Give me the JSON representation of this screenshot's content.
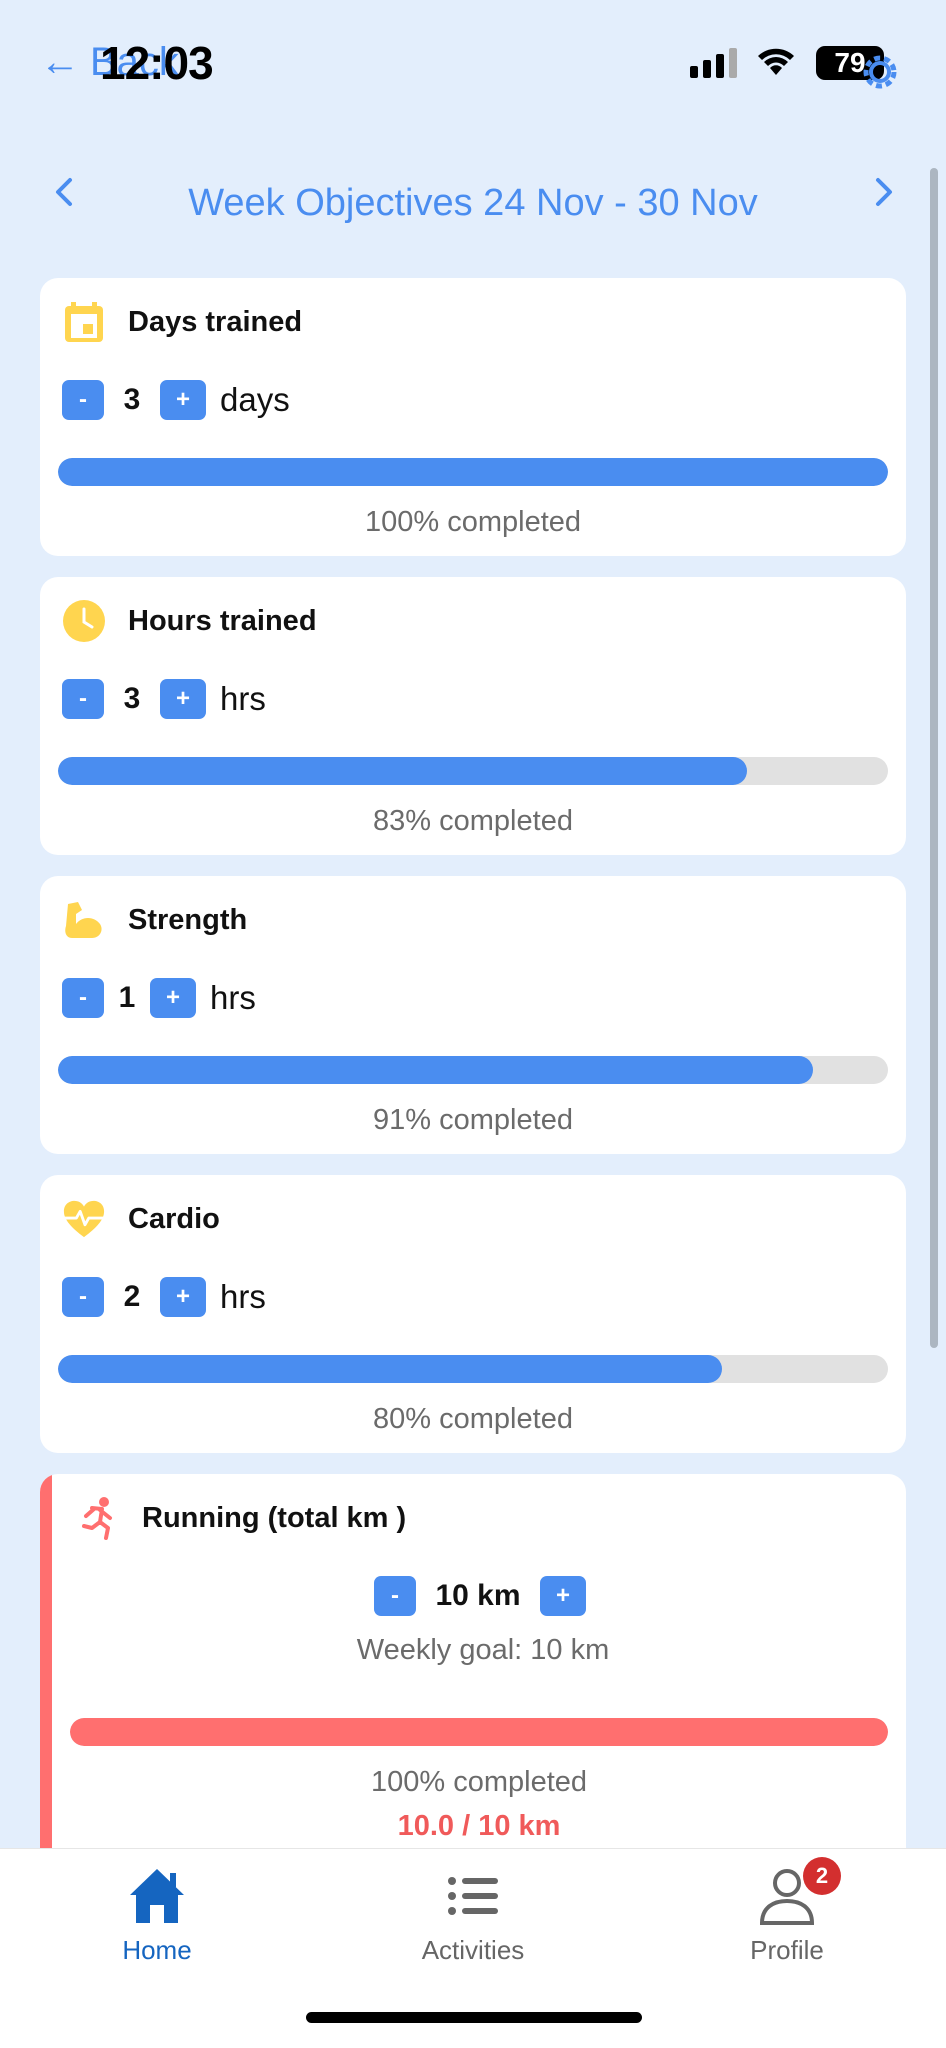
{
  "status": {
    "back_label": "Back",
    "time": "12:03",
    "battery": "79"
  },
  "header": {
    "title": "Week Objectives 24 Nov - 30 Nov"
  },
  "objectives": [
    {
      "title": "Days trained",
      "value": "3",
      "unit": "days",
      "progress_pct": 100,
      "completed_text": "100% completed",
      "icon": "calendar-icon"
    },
    {
      "title": "Hours trained",
      "value": "3",
      "unit": "hrs",
      "progress_pct": 83,
      "completed_text": "83% completed",
      "icon": "clock-icon"
    },
    {
      "title": "Strength",
      "value": "1",
      "unit": "hrs",
      "progress_pct": 91,
      "completed_text": "91% completed",
      "icon": "bicep-icon"
    },
    {
      "title": "Cardio",
      "value": "2",
      "unit": "hrs",
      "progress_pct": 80,
      "completed_text": "80% completed",
      "icon": "heartbeat-icon"
    }
  ],
  "stepper": {
    "minus": "-",
    "plus": "+"
  },
  "running": {
    "title": "Running (total km )",
    "value": "10 km",
    "goal_text": "Weekly goal: 10 km",
    "progress_pct": 100,
    "completed_text": "100% completed",
    "total_text": "10.0 / 10 km",
    "icon": "running-icon",
    "accent_color": "#ff6f6f"
  },
  "tabs": [
    {
      "label": "Home",
      "icon": "home-icon",
      "active": true
    },
    {
      "label": "Activities",
      "icon": "list-icon",
      "active": false
    },
    {
      "label": "Profile",
      "icon": "person-icon",
      "active": false,
      "badge": "2"
    }
  ],
  "colors": {
    "accent": "#4a8df0",
    "background": "#e3eefc",
    "icon_yellow": "#ffd54f",
    "active_tab": "#1565c0",
    "badge": "#d32f2f"
  }
}
